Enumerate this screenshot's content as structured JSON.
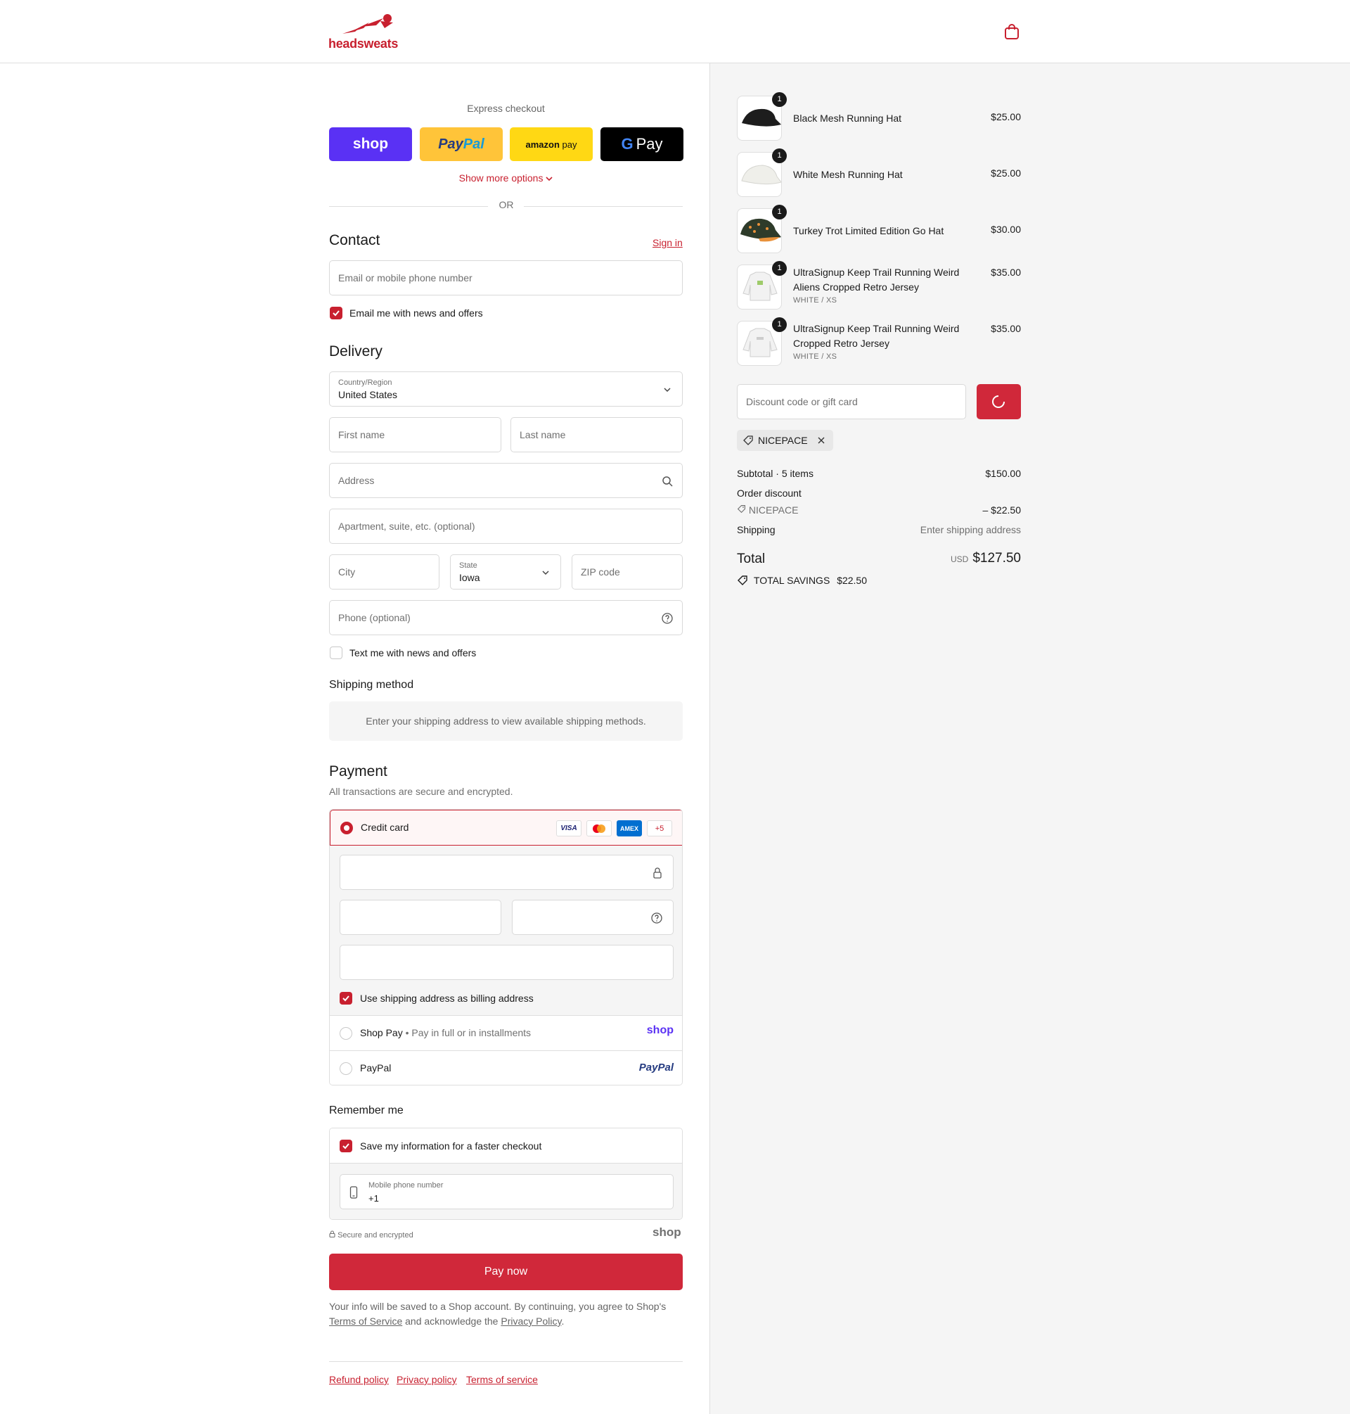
{
  "header": {
    "brand": "headsweats"
  },
  "express": {
    "label": "Express checkout",
    "shop": "shop",
    "paypal_a": "Pay",
    "paypal_b": "Pal",
    "amazon_a": "amazon",
    "amazon_b": "pay",
    "gpay": "Pay",
    "show_more": "Show more options",
    "or": "OR"
  },
  "contact": {
    "title": "Contact",
    "sign_in": "Sign in",
    "email_placeholder": "Email or mobile phone number",
    "email_news_label": "Email me with news and offers",
    "email_news_checked": true
  },
  "delivery": {
    "title": "Delivery",
    "country_label": "Country/Region",
    "country_value": "United States",
    "first_name": "First name",
    "last_name": "Last name",
    "address": "Address",
    "apartment": "Apartment, suite, etc. (optional)",
    "city": "City",
    "state_label": "State",
    "state_value": "Iowa",
    "zip": "ZIP code",
    "phone": "Phone (optional)",
    "text_news_label": "Text me with news and offers",
    "text_news_checked": false
  },
  "shipping_method": {
    "title": "Shipping method",
    "message": "Enter your shipping address to view available shipping methods."
  },
  "payment": {
    "title": "Payment",
    "subtitle": "All transactions are secure and encrypted.",
    "credit_card": "Credit card",
    "card_brands": [
      "VISA",
      "mastercard",
      "AMEX"
    ],
    "more_cards": "+5",
    "billing_label": "Use shipping address as billing address",
    "billing_checked": true,
    "shop_pay": "Shop Pay",
    "shop_pay_sub": "Pay in full or in installments",
    "shop_pay_logo": "shop",
    "paypal": "PayPal",
    "paypal_logo": "PayPal"
  },
  "remember": {
    "title": "Remember me",
    "save_label": "Save my information for a faster checkout",
    "save_checked": true,
    "mobile_label": "Mobile phone number",
    "mobile_value": "+1",
    "secure": "Secure and encrypted",
    "shop_logo": "shop"
  },
  "pay_now": "Pay now",
  "legal": {
    "part1": "Your info will be saved to a Shop account. By continuing, you agree to Shop's",
    "terms": "Terms of Service",
    "part2": "and acknowledge the",
    "privacy": "Privacy Policy",
    "part3": "."
  },
  "footer": {
    "refund": "Refund policy",
    "privacy": "Privacy policy",
    "terms": "Terms of service"
  },
  "items": [
    {
      "name": "Black Mesh Running Hat",
      "variant": "",
      "price": "$25.00",
      "qty": "1"
    },
    {
      "name": "White Mesh Running Hat",
      "variant": "",
      "price": "$25.00",
      "qty": "1"
    },
    {
      "name": "Turkey Trot Limited Edition Go Hat",
      "variant": "",
      "price": "$30.00",
      "qty": "1"
    },
    {
      "name": "UltraSignup Keep Trail Running Weird Aliens Cropped Retro Jersey",
      "variant": "WHITE / XS",
      "price": "$35.00",
      "qty": "1"
    },
    {
      "name": "UltraSignup Keep Trail Running Weird Cropped Retro Jersey",
      "variant": "WHITE / XS",
      "price": "$35.00",
      "qty": "1"
    }
  ],
  "discount": {
    "placeholder": "Discount code or gift card",
    "applied_code": "NICEPACE"
  },
  "totals": {
    "subtotal_label": "Subtotal · 5 items",
    "subtotal_value": "$150.00",
    "order_discount_label": "Order discount",
    "discount_code": "NICEPACE",
    "discount_value": "– $22.50",
    "shipping_label": "Shipping",
    "shipping_value": "Enter shipping address",
    "total_label": "Total",
    "currency": "USD",
    "total_value": "$127.50",
    "savings_label": "TOTAL SAVINGS",
    "savings_value": "$22.50"
  },
  "colors": {
    "accent": "#c8202f",
    "shop_purple": "#5a31f4",
    "paypal_yellow": "#ffc439",
    "amazon_yellow": "#ffd814"
  }
}
